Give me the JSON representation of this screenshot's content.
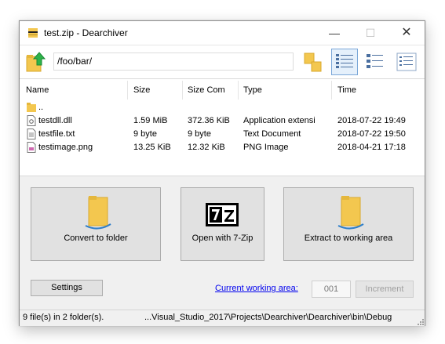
{
  "window": {
    "title": "test.zip - Dearchiver"
  },
  "toolbar": {
    "path": "/foo/bar/",
    "up_icon": "folder-up-icon",
    "view_tile_icon": "tile-view-icon",
    "view_details_icon": "details-view-icon",
    "view_list_icon": "list-view-icon",
    "view_small_icon": "small-icons-view-icon"
  },
  "columns": [
    "Name",
    "Size",
    "Size Com",
    "Type",
    "Time"
  ],
  "files": [
    {
      "name": "..",
      "size": "",
      "size_com": "",
      "type": "",
      "time": "",
      "icon": "folder-icon"
    },
    {
      "name": "testdll.dll",
      "size": "1.59 MiB",
      "size_com": "372.36 KiB",
      "type": "Application extensi",
      "time": "2018-07-22 19:49",
      "icon": "dll-file-icon"
    },
    {
      "name": "testfile.txt",
      "size": "9 byte",
      "size_com": "9 byte",
      "type": "Text Document",
      "time": "2018-07-22 19:50",
      "icon": "text-file-icon"
    },
    {
      "name": "testimage.png",
      "size": "13.25 KiB",
      "size_com": "12.32 KiB",
      "type": "PNG Image",
      "time": "2018-04-21 17:18",
      "icon": "image-file-icon"
    }
  ],
  "actions": {
    "convert_label": "Convert to folder",
    "open7z_label": "Open with 7-Zip",
    "extract_label": "Extract to working area"
  },
  "bottom": {
    "settings_label": "Settings",
    "cwa_label": "Current working area:",
    "cwa_value": "001",
    "increment_label": "Increment"
  },
  "status": {
    "count": "9 file(s) in 2 folder(s).",
    "path": "...Visual_Studio_2017\\Projects\\Dearchiver\\Dearchiver\\bin\\Debug"
  },
  "colors": {
    "link": "#0000ee",
    "folder": "#f3c74f",
    "selected_view_bg": "#e5f0fb",
    "selected_view_border": "#7aa7d8"
  }
}
